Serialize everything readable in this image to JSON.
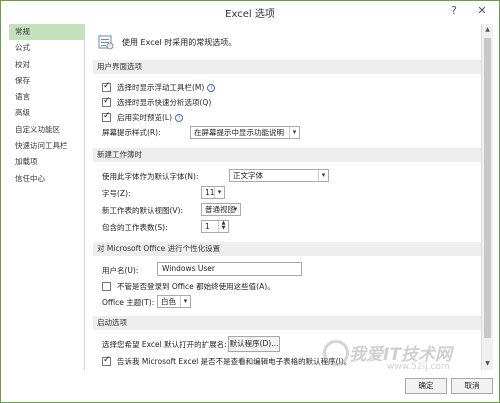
{
  "window": {
    "title": "Excel 选项",
    "help_glyph": "?",
    "close_glyph": "✕"
  },
  "sidebar": {
    "items": [
      {
        "label": "常规",
        "active": true
      },
      {
        "label": "公式"
      },
      {
        "label": "校对"
      },
      {
        "label": "保存"
      },
      {
        "label": "语言"
      },
      {
        "label": "高级"
      },
      {
        "label": "自定义功能区"
      },
      {
        "label": "快速访问工具栏"
      },
      {
        "label": "加载项"
      },
      {
        "label": "信任中心"
      }
    ]
  },
  "main": {
    "header_text": "使用 Excel 时采用的常规选项。",
    "ui_section": {
      "title": "用户界面选项",
      "opt_minitoolbar": "选择时显示浮动工具栏(M)",
      "opt_quickanalysis": "选择时显示快速分析选项(Q)",
      "opt_livepreview": "启用实时预览(L)",
      "screentip_label": "屏幕提示样式(R):",
      "screentip_value": "在屏幕提示中显示功能说明"
    },
    "new_workbook_section": {
      "title": "新建工作簿时",
      "font_label": "使用此字体作为默认字体(N):",
      "font_value": "正文字体",
      "size_label": "字号(Z):",
      "size_value": "11",
      "view_label": "新工作表的默认视图(V):",
      "view_value": "普通视图",
      "sheets_label": "包含的工作表数(S):",
      "sheets_value": "1"
    },
    "personalize_section": {
      "title": "对 Microsoft Office 进行个性化设置",
      "username_label": "用户名(U):",
      "username_value": "Windows User",
      "always_use": "不管是否登录到 Office 都始终使用这些值(A)。",
      "theme_label": "Office 主题(T):",
      "theme_value": "白色"
    },
    "startup_section": {
      "title": "启动选项",
      "default_program_label": "选择您希望 Excel 默认打开的扩展名:",
      "default_program_button": "默认程序(D)...",
      "tell_me": "告诉我 Microsoft Excel 是否不是查看和编辑电子表格的默认程序(I)。"
    }
  },
  "footer": {
    "ok": "确定",
    "cancel": "取消"
  },
  "watermark": {
    "text": "我爱IT技术网",
    "url": "www.52ij.com"
  },
  "colors": {
    "active_nav": "#c4e0bc",
    "section_bg": "#eeeeee",
    "border_green": "#6f9a54"
  }
}
